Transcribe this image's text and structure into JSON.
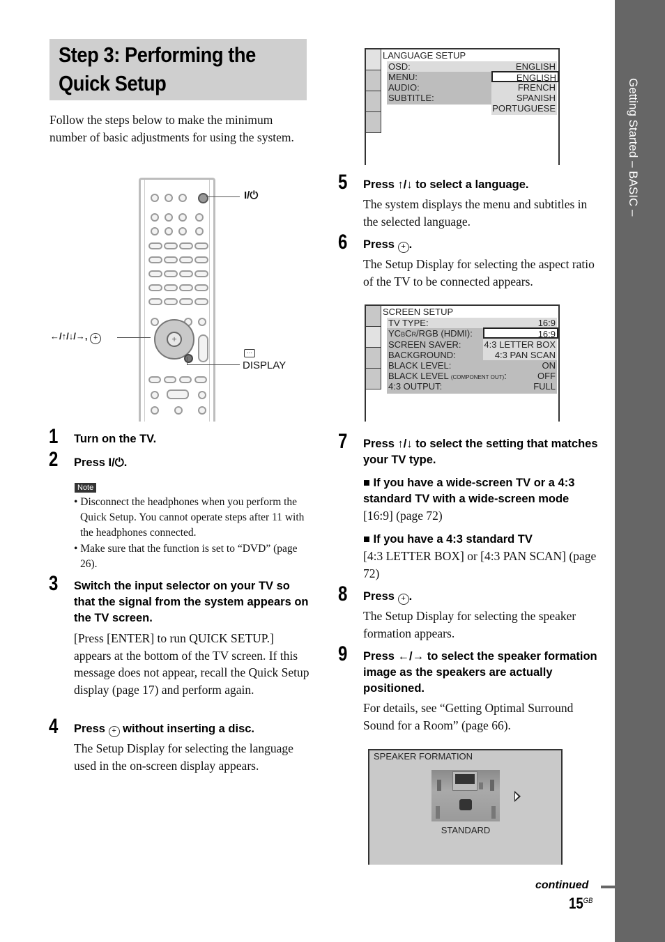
{
  "section_tab": "Getting Started – BASIC –",
  "title_lines": [
    "Step 3: Performing the",
    "Quick Setup"
  ],
  "intro": "Follow the steps below to make the minimum number of basic adjustments for using the system.",
  "remote_callouts": {
    "power": "I/⏻",
    "arrows_enter": "←/↑/↓/→,",
    "display_icon": "…",
    "display": "DISPLAY"
  },
  "steps": [
    {
      "num": "1",
      "head": "Turn on the TV."
    },
    {
      "num": "2",
      "head": "Press I/⏻."
    },
    {
      "num": "3",
      "head": "Switch the input selector on your TV so that the signal from the system appears on the TV screen.",
      "body": "[Press [ENTER] to run QUICK SETUP.] appears at the bottom of the TV screen. If this message does not appear, recall the Quick Setup display (page 17) and perform again."
    },
    {
      "num": "4",
      "head_a": "Press",
      "head_b": "without inserting a disc.",
      "body": "The Setup Display for selecting the language used in the on-screen display appears."
    },
    {
      "num": "5",
      "head": "Press ↑/↓ to select a language.",
      "body": "The system displays the menu and subtitles in the selected language."
    },
    {
      "num": "6",
      "head_a": "Press",
      "head_b": ".",
      "body": "The Setup Display for selecting the aspect ratio of the TV to be connected appears."
    },
    {
      "num": "7",
      "head": "Press ↑/↓ to select the setting that matches your TV type.",
      "cases": [
        {
          "head": "■ If you have a wide-screen TV or a 4:3 standard TV with a wide-screen mode",
          "body": "[16:9] (page 72)"
        },
        {
          "head": "■ If you have a 4:3 standard TV",
          "body": "[4:3 LETTER BOX] or [4:3 PAN SCAN] (page 72)"
        }
      ]
    },
    {
      "num": "8",
      "head_a": "Press",
      "head_b": ".",
      "body": "The Setup Display for selecting the speaker formation appears."
    },
    {
      "num": "9",
      "head": "Press ←/→ to select the speaker formation image as the speakers are actually positioned.",
      "body": "For details, see “Getting Optimal Surround Sound for a Room” (page 66)."
    }
  ],
  "enter_symbol": "+",
  "note": {
    "label": "Note",
    "items": [
      "• Disconnect the headphones when you perform the Quick Setup. You cannot operate steps after 11 with the headphones connected.",
      "• Make sure that the function is set to “DVD” (page 26)."
    ]
  },
  "language_setup": {
    "title": "LANGUAGE SETUP",
    "rows": [
      {
        "label": "OSD:",
        "value": "ENGLISH"
      },
      {
        "label": "MENU:",
        "value": "ENGLISH"
      },
      {
        "label": "AUDIO:",
        "value": "FRENCH"
      },
      {
        "label": "SUBTITLE:",
        "value": "SPANISH"
      }
    ],
    "options": [
      "ENGLISH",
      "FRENCH",
      "SPANISH",
      "PORTUGUESE"
    ],
    "selected_option": "ENGLISH"
  },
  "screen_setup": {
    "title": "SCREEN SETUP",
    "rows": [
      {
        "label": "TV TYPE:",
        "value": "16:9"
      },
      {
        "label": "YCBCR/RGB (HDMI):",
        "value": "16:9"
      },
      {
        "label": "SCREEN SAVER:",
        "value": "4:3 LETTER BOX"
      },
      {
        "label": "BACKGROUND:",
        "value": "4:3 PAN SCAN"
      },
      {
        "label": "BLACK LEVEL:",
        "value": "ON"
      },
      {
        "label": "BLACK LEVEL",
        "label_small": "(COMPONENT OUT)",
        "label_suffix": ":",
        "value": "OFF"
      },
      {
        "label": "4:3 OUTPUT:",
        "value": "FULL"
      }
    ],
    "options": [
      "16:9",
      "4:3 LETTER BOX",
      "4:3 PAN SCAN"
    ],
    "selected_option": "16:9"
  },
  "speaker_formation": {
    "title": "SPEAKER FORMATION",
    "selection": "STANDARD"
  },
  "footer": {
    "continued": "continued",
    "page": "15",
    "page_suffix": "GB"
  }
}
